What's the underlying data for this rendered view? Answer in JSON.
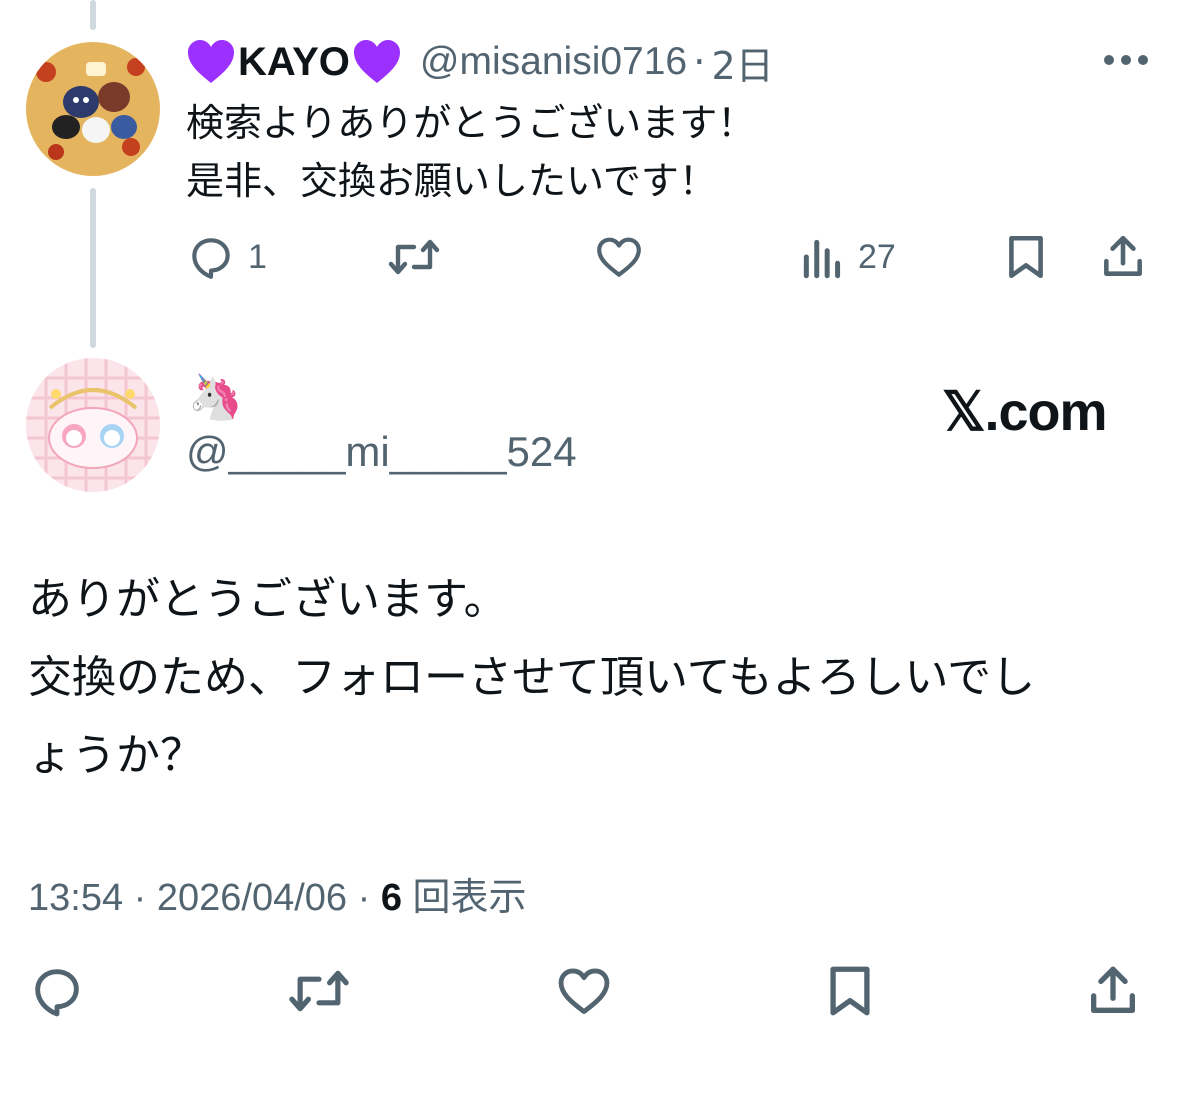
{
  "reply": {
    "display_name": "KAYO",
    "handle": "@misanisi0716",
    "separator": "·",
    "time_ago": "2日",
    "text_lines": [
      "検索よりありがとうございます！",
      "是非、交換お願いしたいです！"
    ],
    "reply_count": "1",
    "views_count": "27",
    "icons": [
      "purple-heart",
      "more-icon",
      "reply-icon",
      "retweet-icon",
      "like-icon",
      "views-icon",
      "bookmark-icon",
      "share-icon"
    ]
  },
  "post": {
    "display_name": "🦄",
    "handle": "@_____mi_____524",
    "watermark": "𝕏.com",
    "text_lines": [
      "ありがとうございます。",
      "交換のため、フォローさせて頂いてもよろしいでし",
      "ょうか？"
    ],
    "time": "13:54",
    "separator": "·",
    "date": "2026/04/06",
    "views_count": "6",
    "views_label": "回表示",
    "icons": [
      "reply-icon",
      "retweet-icon",
      "like-icon",
      "bookmark-icon",
      "share-icon"
    ]
  },
  "colors": {
    "text": "#0f1419",
    "secondary": "#536471",
    "thread_line": "#cfd9de",
    "heart": "#9b30ff"
  }
}
